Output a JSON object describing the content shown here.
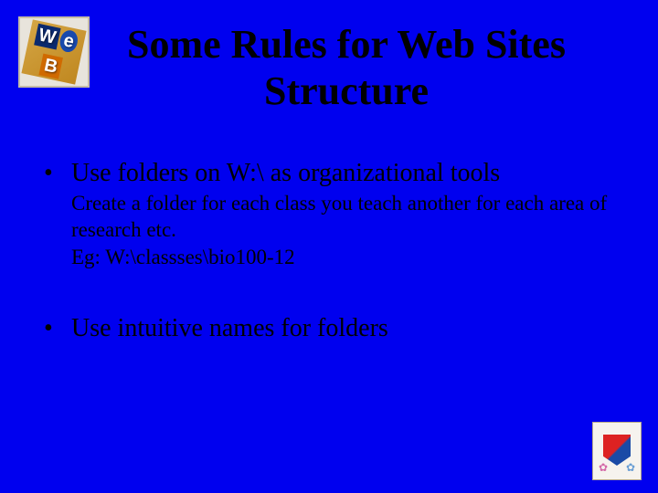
{
  "title": "Some Rules for Web Sites Structure",
  "bullets": [
    {
      "main": "Use folders on W:\\ as organizational tools",
      "sub1": "Create a folder for each class you teach another for each area of research etc.",
      "sub2": "Eg: W:\\classses\\bio100-12"
    },
    {
      "main": "Use intuitive names for folders"
    }
  ],
  "logo_letters": {
    "w": "W",
    "e": "e",
    "b": "B"
  }
}
